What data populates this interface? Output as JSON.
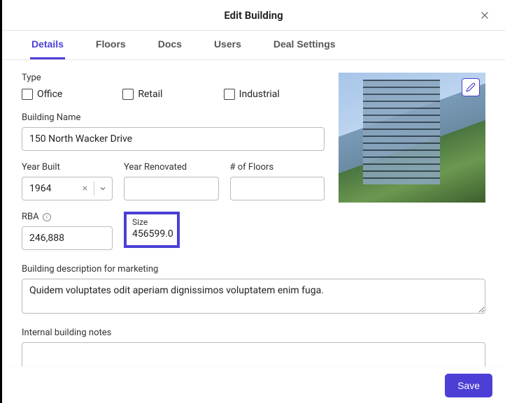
{
  "header": {
    "title": "Edit Building"
  },
  "tabs": {
    "details": "Details",
    "floors": "Floors",
    "docs": "Docs",
    "users": "Users",
    "deal_settings": "Deal Settings"
  },
  "form": {
    "type_label": "Type",
    "type_options": {
      "office": "Office",
      "retail": "Retail",
      "industrial": "Industrial"
    },
    "building_name_label": "Building Name",
    "building_name_value": "150 North Wacker Drive",
    "year_built_label": "Year Built",
    "year_built_value": "1964",
    "year_renovated_label": "Year Renovated",
    "year_renovated_value": "",
    "floors_label": "# of Floors",
    "floors_value": "",
    "rba_label": "RBA",
    "rba_value": "246,888",
    "size_label": "Size",
    "size_value": "456599.0",
    "description_label": "Building description for marketing",
    "description_value": "Quidem voluptates odit aperiam dignissimos voluptatem enim fuga.",
    "internal_notes_label": "Internal building notes",
    "internal_notes_value": ""
  },
  "footer": {
    "save": "Save"
  }
}
